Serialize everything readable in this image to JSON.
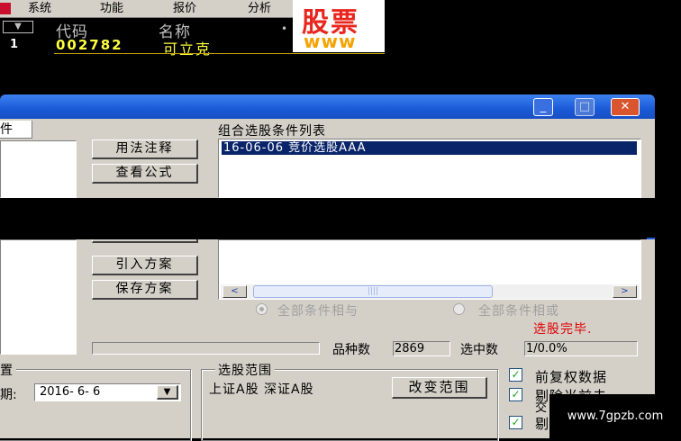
{
  "menu": {
    "items": [
      "系统",
      "功能",
      "报价",
      "分析"
    ]
  },
  "quote": {
    "dropdown_glyph": "▼",
    "headers": {
      "code": "代码",
      "name": "名称",
      "marker": "•"
    },
    "row": {
      "index": "1",
      "code": "002782",
      "name": "可立克"
    }
  },
  "banner": {
    "text_cn": "股票",
    "text_en": "www"
  },
  "titlebar": {
    "min": "_",
    "max": "□",
    "close": "✕"
  },
  "left_panel": {
    "tab_label": "件"
  },
  "buttons": {
    "usage": "用法注释",
    "view_formula": "查看公式",
    "import_plan": "引入方案",
    "save_plan": "保存方案"
  },
  "condition_list": {
    "title": "组合选股条件列表",
    "items": [
      "16-06-06 竞价选股AAA"
    ]
  },
  "scrollbar": {
    "left": "<",
    "right": ">",
    "thumb": "||||"
  },
  "logic": {
    "and_label": "全部条件相与",
    "or_label": "全部条件相或",
    "selected": "and"
  },
  "status": {
    "message": "选股完毕.",
    "message_color": "#e00000"
  },
  "stats": {
    "count_label": "品种数",
    "count_value": "2869",
    "selected_label": "选中数",
    "selected_value": "1/0.0%"
  },
  "period": {
    "group_title": "置",
    "date_label": "期:",
    "date_value": "2016- 6- 6"
  },
  "range": {
    "group_title": "选股范围",
    "markets": "上证A股 深证A股",
    "change_button": "改变范围"
  },
  "options": {
    "items": [
      {
        "label": "前复权数据",
        "checked": true
      },
      {
        "label": "剔除当前未",
        "label2": "交",
        "checked": true
      },
      {
        "label": "剔",
        "checked": true
      }
    ]
  },
  "watermark": "www.7gpzb.com"
}
